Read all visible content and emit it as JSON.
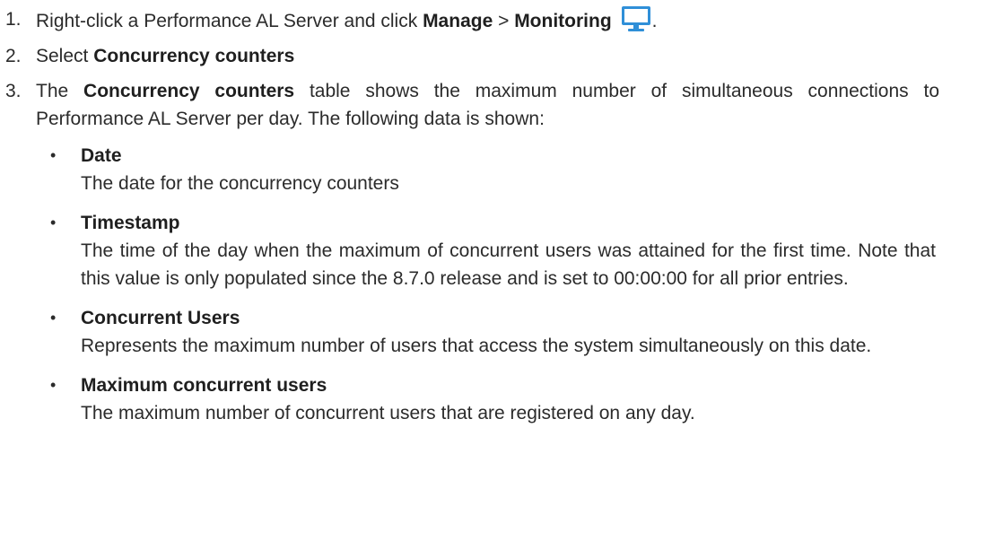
{
  "steps": [
    {
      "number": "1.",
      "parts": {
        "before": "Right-click a Performance AL Server and click ",
        "manage": "Manage",
        "separator": " > ",
        "monitoring": "Monitoring",
        "after": "."
      },
      "icon": "monitor-icon"
    },
    {
      "number": "2.",
      "parts": {
        "before": "Select ",
        "bold": "Concurrency counters"
      }
    },
    {
      "number": "3.",
      "parts": {
        "before": "The ",
        "bold": "Concurrency counters",
        "after": " table shows the maximum number of simultaneous connections to Performance AL Server per day. The following data is shown:"
      }
    }
  ],
  "fields": [
    {
      "title": "Date",
      "description": "The date for the concurrency counters"
    },
    {
      "title": "Timestamp",
      "description": "The time of the day when the maximum of concurrent users was attained for the first time. Note that this value is only populated since the 8.7.0 release and is set to 00:00:00 for all prior entries."
    },
    {
      "title": "Concurrent Users",
      "description": "Represents the maximum number of users that access the system simultaneously on this date."
    },
    {
      "title": "Maximum concurrent users",
      "description": "The maximum number of concurrent users that are registered on any day."
    }
  ],
  "bullet_glyph": "•",
  "colors": {
    "text": "#2b2b2b",
    "icon_blue": "#2f8fd8"
  }
}
